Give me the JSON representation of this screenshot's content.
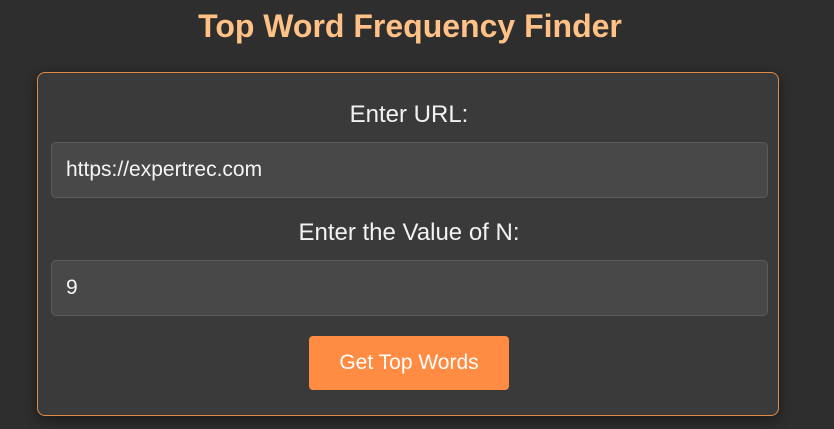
{
  "page": {
    "title": "Top Word Frequency Finder"
  },
  "form": {
    "url_label": "Enter URL:",
    "url_value": "https://expertrec.com",
    "n_label": "Enter the Value of N:",
    "n_value": "9",
    "submit_label": "Get Top Words"
  },
  "colors": {
    "background": "#2e2e2e",
    "title": "#ffc185",
    "card_border": "#e08a4a",
    "button": "#ff8c42"
  }
}
